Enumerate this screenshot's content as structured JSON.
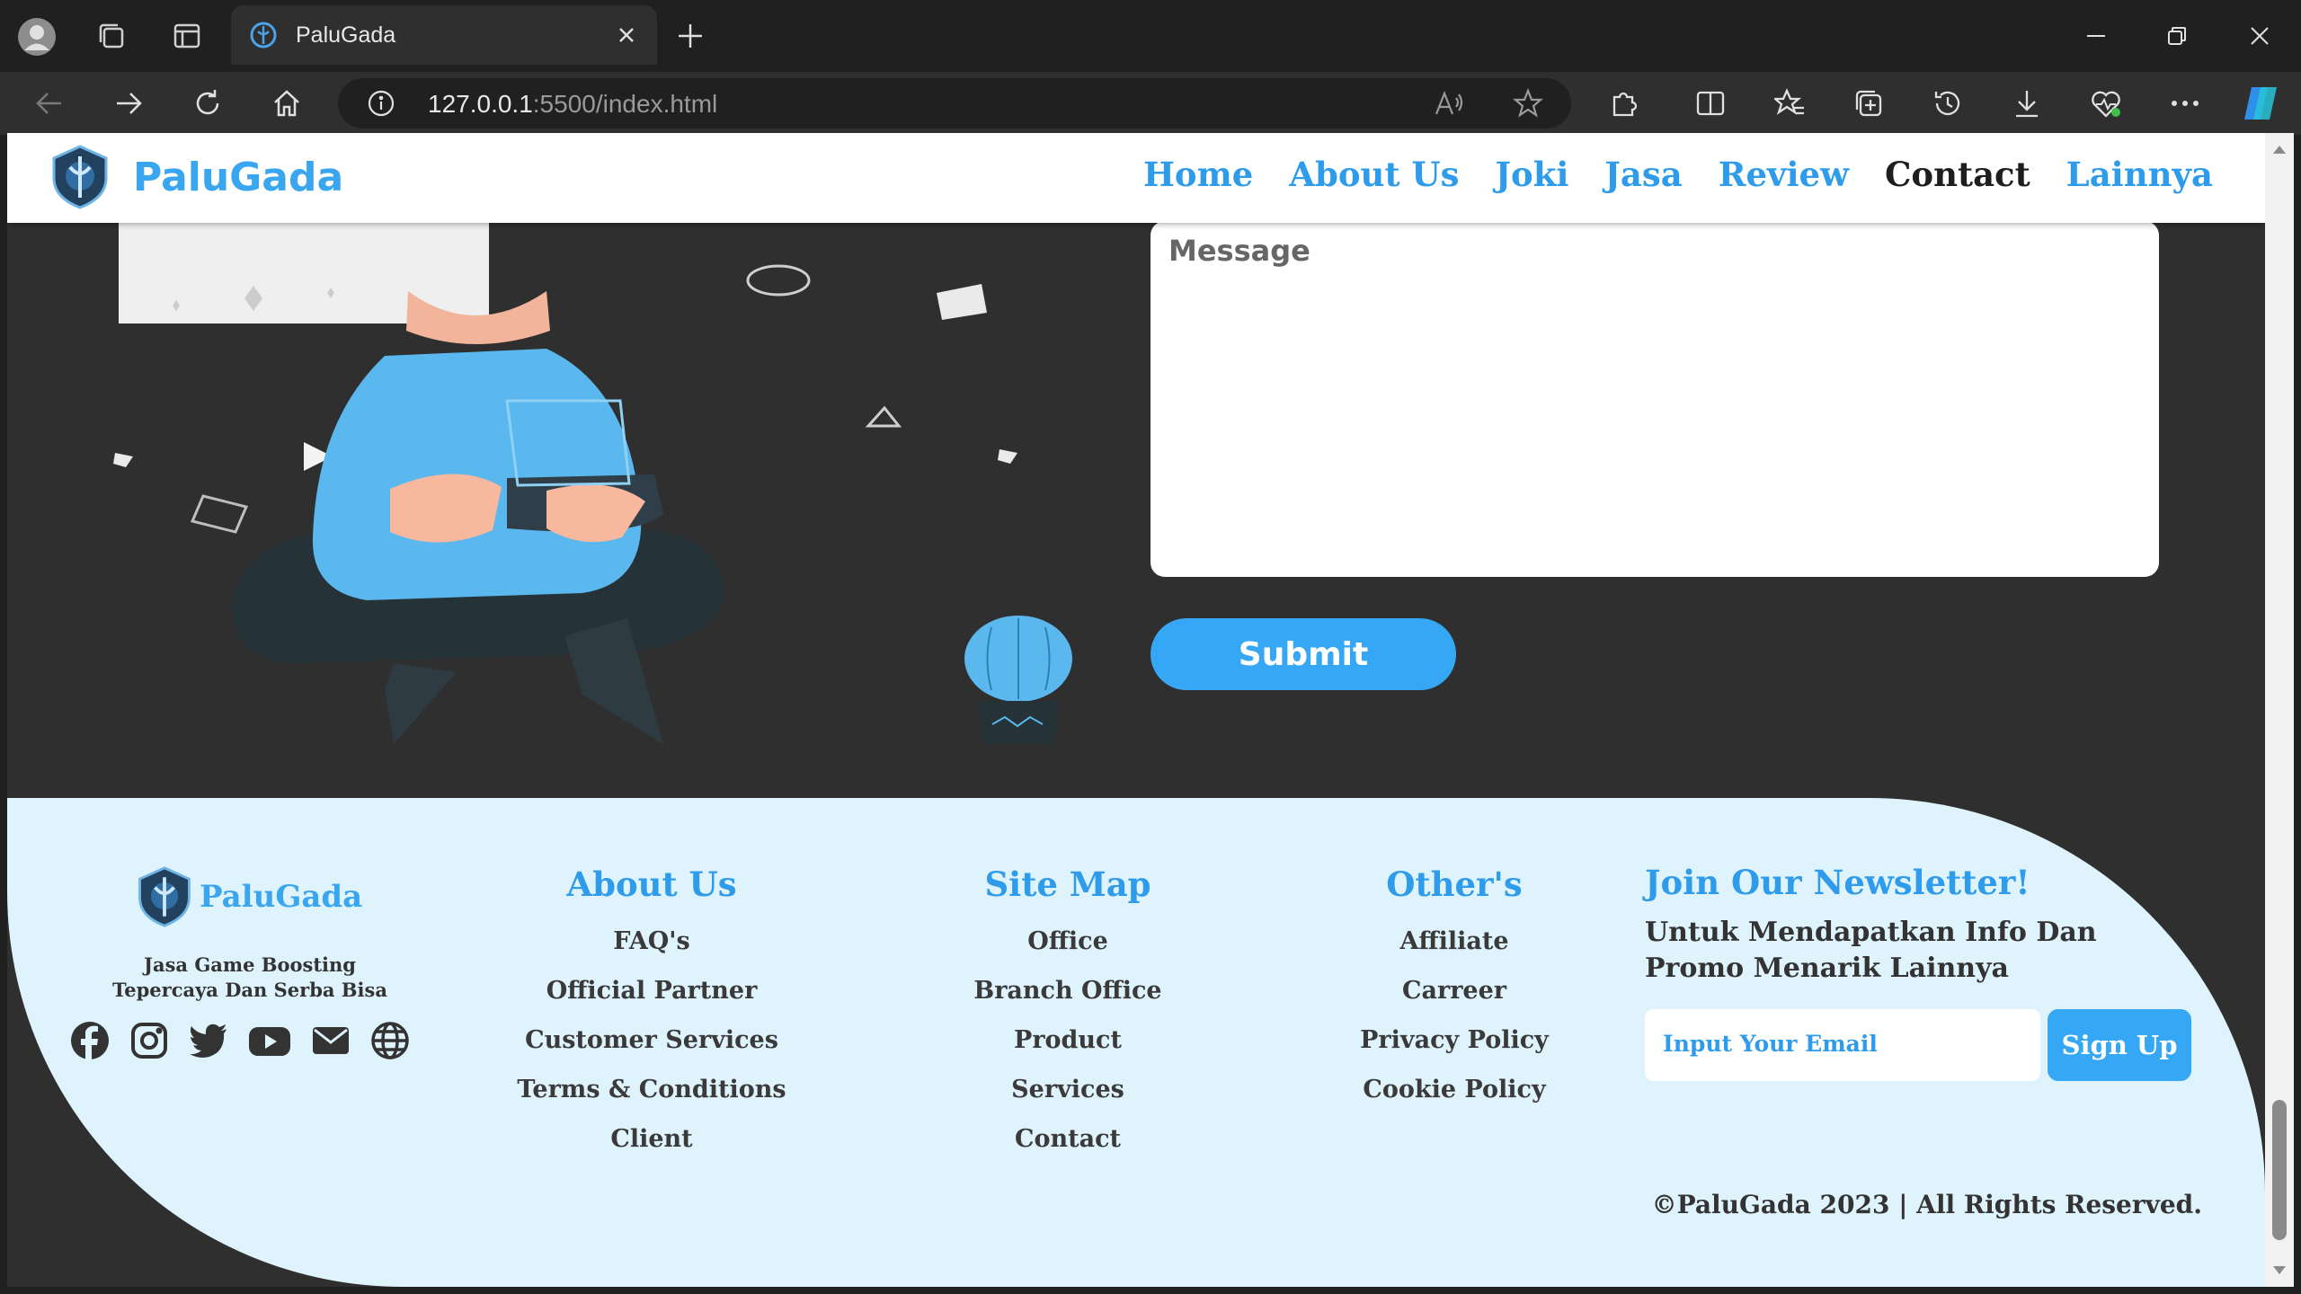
{
  "browser": {
    "tab_title": "PaluGada",
    "url_host": "127.0.0.1",
    "url_rest": ":5500/index.html"
  },
  "site": {
    "brand": "PaluGada",
    "nav": [
      "Home",
      "About Us",
      "Joki",
      "Jasa",
      "Review",
      "Contact",
      "Lainnya"
    ],
    "active_nav": "Contact"
  },
  "contact": {
    "message_placeholder": "Message",
    "submit_label": "Submit"
  },
  "footer": {
    "brand": "PaluGada",
    "tagline_line1": "Jasa Game Boosting",
    "tagline_line2": "Tepercaya Dan Serba Bisa",
    "socials": [
      "facebook-icon",
      "instagram-icon",
      "twitter-icon",
      "youtube-icon",
      "mail-icon",
      "globe-icon"
    ],
    "about": {
      "title": "About Us",
      "links": [
        "FAQ's",
        "Official Partner",
        "Customer Services",
        "Terms & Conditions",
        "Client"
      ]
    },
    "sitemap": {
      "title": "Site Map",
      "links": [
        "Office",
        "Branch Office",
        "Product",
        "Services",
        "Contact"
      ]
    },
    "others": {
      "title": "Other's",
      "links": [
        "Affiliate",
        "Carreer",
        "Privacy Policy",
        "Cookie Policy"
      ]
    },
    "newsletter": {
      "title": "Join Our Newsletter!",
      "text": "Untuk Mendapatkan Info Dan Promo Menarik Lainnya",
      "email_placeholder": "Input Your Email",
      "signup_label": "Sign Up"
    },
    "copyright": "©PaluGada 2023 | All Rights Reserved."
  },
  "colors": {
    "accent": "#35a7f5",
    "footer_bg": "#dff3fd",
    "page_bg": "#2f2f2f"
  }
}
